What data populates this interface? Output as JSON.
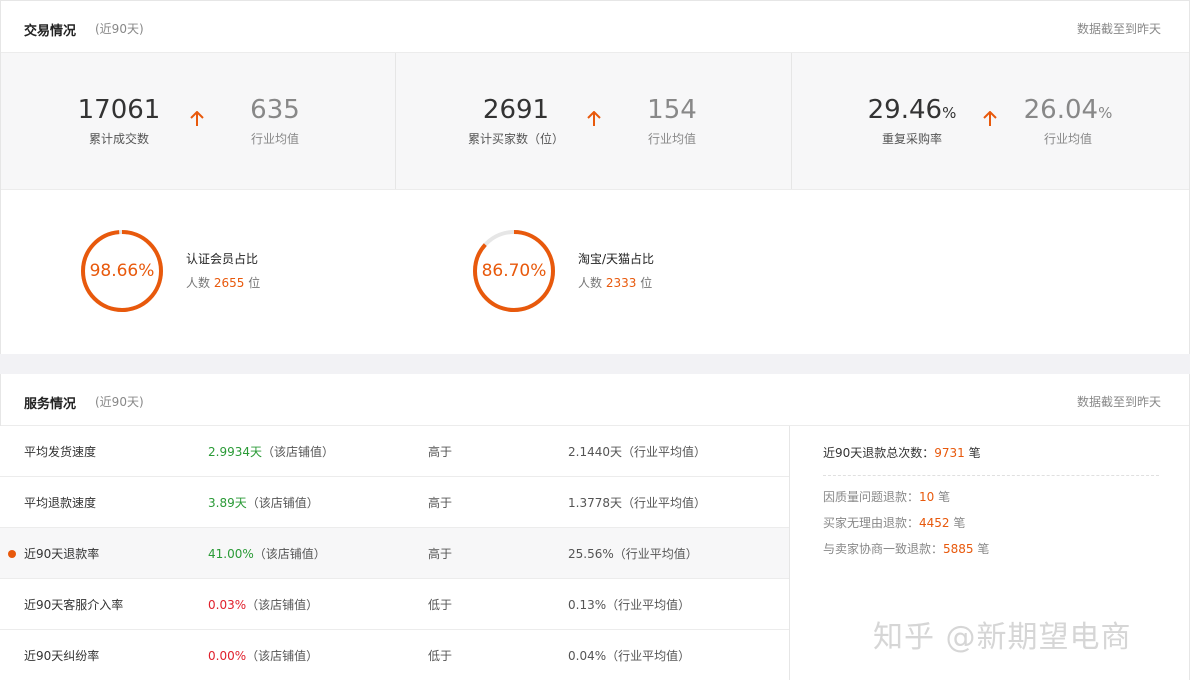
{
  "trade": {
    "title": "交易情况",
    "period": "(近90天)",
    "note": "数据截至到昨天",
    "stats": [
      {
        "value": "17061",
        "unit": "",
        "label": "累计成交数",
        "industry_value": "635",
        "industry_unit": "",
        "industry_label": "行业均值"
      },
      {
        "value": "2691",
        "unit": "",
        "label": "累计买家数（位）",
        "industry_value": "154",
        "industry_unit": "",
        "industry_label": "行业均值"
      },
      {
        "value": "29.46",
        "unit": "%",
        "label": "重复采购率",
        "industry_value": "26.04",
        "industry_unit": "%",
        "industry_label": "行业均值"
      }
    ],
    "rings": [
      {
        "percent_text": "98.66%",
        "fraction": 0.9866,
        "label": "认证会员占比",
        "count_prefix": "人数",
        "count": "2655",
        "count_suffix": "位"
      },
      {
        "percent_text": "86.70%",
        "fraction": 0.867,
        "label": "淘宝/天猫占比",
        "count_prefix": "人数",
        "count": "2333",
        "count_suffix": "位"
      }
    ],
    "up_icon": "arrow-up-icon",
    "accent": "#e8590c"
  },
  "service": {
    "title": "服务情况",
    "period": "(近90天)",
    "note": "数据截至到昨天",
    "rows": [
      {
        "name": "平均发货速度",
        "value": "2.9934天",
        "value_suffix": "（该店铺值）",
        "compare": "高于",
        "industry": "2.1440天（行业平均值）",
        "color": "green"
      },
      {
        "name": "平均退款速度",
        "value": "3.89天",
        "value_suffix": "（该店铺值）",
        "compare": "高于",
        "industry": "1.3778天（行业平均值）",
        "color": "green"
      },
      {
        "name": "近90天退款率",
        "value": "41.00%",
        "value_suffix": "（该店铺值）",
        "compare": "高于",
        "industry": "25.56%（行业平均值）",
        "color": "green"
      },
      {
        "name": "近90天客服介入率",
        "value": "0.03%",
        "value_suffix": "（该店铺值）",
        "compare": "低于",
        "industry": "0.13%（行业平均值）",
        "color": "red"
      },
      {
        "name": "近90天纠纷率",
        "value": "0.00%",
        "value_suffix": "（该店铺值）",
        "compare": "低于",
        "industry": "0.04%（行业平均值）",
        "color": "red"
      }
    ],
    "refund_total": {
      "label": "近90天退款总次数：",
      "value": "9731",
      "unit": "笔"
    },
    "refund_breakdown": [
      {
        "label": "因质量问题退款：",
        "value": "10",
        "unit": "笔"
      },
      {
        "label": "买家无理由退款：",
        "value": "4452",
        "unit": "笔"
      },
      {
        "label": "与卖家协商一致退款：",
        "value": "5885",
        "unit": "笔"
      }
    ]
  },
  "watermark": "知乎 @新期望电商"
}
